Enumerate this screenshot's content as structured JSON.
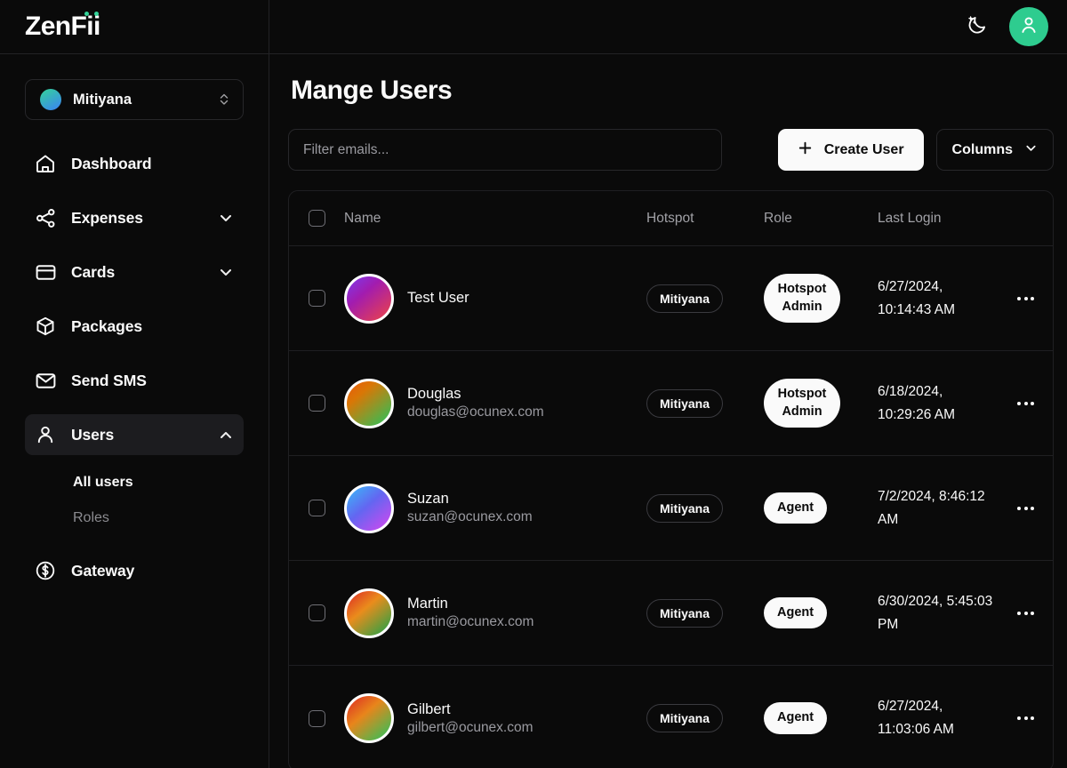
{
  "brand": {
    "name": "ZenFii",
    "accent_color": "#34d399"
  },
  "sidebar": {
    "org_selector": {
      "name": "Mitiyana",
      "icon": "chevrons-up-down-icon"
    },
    "items": [
      {
        "label": "Dashboard",
        "icon": "home-icon",
        "expandable": false,
        "active": false
      },
      {
        "label": "Expenses",
        "icon": "share-network-icon",
        "expandable": true,
        "expanded": false,
        "active": false
      },
      {
        "label": "Cards",
        "icon": "credit-card-icon",
        "expandable": true,
        "expanded": false,
        "active": false
      },
      {
        "label": "Packages",
        "icon": "package-box-icon",
        "expandable": false,
        "active": false
      },
      {
        "label": "Send SMS",
        "icon": "envelope-icon",
        "expandable": false,
        "active": false
      },
      {
        "label": "Users",
        "icon": "user-icon",
        "expandable": true,
        "expanded": true,
        "active": true
      },
      {
        "label": "Gateway",
        "icon": "dollar-circle-icon",
        "expandable": false,
        "active": false
      }
    ],
    "users_subitems": [
      {
        "label": "All users",
        "active": true
      },
      {
        "label": "Roles",
        "active": false
      }
    ]
  },
  "topbar": {
    "theme_toggle_icon": "moon-stars-icon",
    "avatar_icon": "user-icon",
    "avatar_color": "#2ecc8f"
  },
  "main": {
    "page_title": "Mange Users",
    "filter": {
      "value": "",
      "placeholder": "Filter emails..."
    },
    "create_button": {
      "label": "Create User",
      "icon": "plus-icon"
    },
    "columns_button": {
      "label": "Columns",
      "icon": "chevron-down-icon"
    }
  },
  "table": {
    "columns": [
      "Name",
      "Hotspot",
      "Role",
      "Last Login"
    ],
    "select_all_checked": false,
    "rows": [
      {
        "checked": false,
        "name": "Test User",
        "email": "",
        "avatar_gradient": "linear-gradient(140deg, #7c3aed 0%, #a21caf 38%, #ef4444 100%)",
        "hotspot": "Mitiyana",
        "role": "Hotspot Admin",
        "last_login": "6/27/2024, 10:14:43 AM",
        "actions_icon": "ellipsis-icon"
      },
      {
        "checked": false,
        "name": "Douglas",
        "email": "douglas@ocunex.com",
        "avatar_gradient": "linear-gradient(140deg, #ea580c 0%, #d97706 30%, #22c55e 100%)",
        "hotspot": "Mitiyana",
        "role": "Hotspot Admin",
        "last_login": "6/18/2024, 10:29:26 AM",
        "actions_icon": "ellipsis-icon"
      },
      {
        "checked": false,
        "name": "Suzan",
        "email": "suzan@ocunex.com",
        "avatar_gradient": "linear-gradient(140deg, #38bdf8 0%, #6366f1 45%, #d946ef 100%)",
        "hotspot": "Mitiyana",
        "role": "Agent",
        "last_login": "7/2/2024, 8:46:12 AM",
        "actions_icon": "ellipsis-icon"
      },
      {
        "checked": false,
        "name": "Martin",
        "email": "martin@ocunex.com",
        "avatar_gradient": "linear-gradient(140deg, #dc2626 0%, #ea8c1c 40%, #16a34a 100%)",
        "hotspot": "Mitiyana",
        "role": "Agent",
        "last_login": "6/30/2024, 5:45:03 PM",
        "actions_icon": "ellipsis-icon"
      },
      {
        "checked": false,
        "name": "Gilbert",
        "email": "gilbert@ocunex.com",
        "avatar_gradient": "linear-gradient(140deg, #dc2626 0%, #e8851b 40%, #22c55e 100%)",
        "hotspot": "Mitiyana",
        "role": "Agent",
        "last_login": "6/27/2024, 11:03:06 AM",
        "actions_icon": "ellipsis-icon"
      }
    ]
  }
}
